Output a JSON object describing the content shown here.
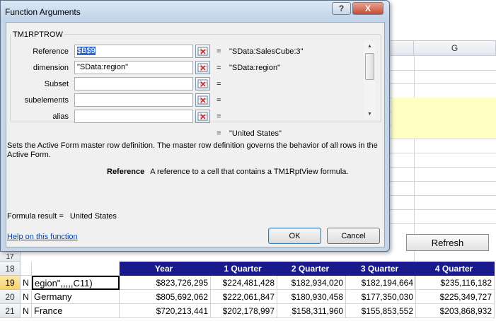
{
  "sheet": {
    "col_g": "G",
    "refresh": "Refresh",
    "row17": "17",
    "header": {
      "num": "18",
      "cols": [
        "Year",
        "1 Quarter",
        "2 Quarter",
        "3 Quarter",
        "4 Quarter"
      ]
    },
    "rows": [
      {
        "num": "19",
        "n": "N",
        "name": "egion\",,,,,C11)",
        "vals": [
          "$823,726,295",
          "$224,481,428",
          "$182,934,020",
          "$182,194,664",
          "$235,116,182"
        ]
      },
      {
        "num": "20",
        "n": "N",
        "name": "Germany",
        "vals": [
          "$805,692,062",
          "$222,061,847",
          "$180,930,458",
          "$177,350,030",
          "$225,349,727"
        ]
      },
      {
        "num": "21",
        "n": "N",
        "name": "France",
        "vals": [
          "$720,213,441",
          "$202,178,997",
          "$158,311,960",
          "$155,853,552",
          "$203,868,932"
        ]
      }
    ]
  },
  "dialog": {
    "title": "Function Arguments",
    "help_btn": "?",
    "close_btn": "X",
    "function_name": "TM1RPTROW",
    "args": [
      {
        "label": "Reference",
        "value": "$B$9",
        "result": "\"SData:SalesCube:3\""
      },
      {
        "label": "dimension",
        "value": "\"SData:region\"",
        "result": "\"SData:region\""
      },
      {
        "label": "Subset",
        "value": "",
        "result": ""
      },
      {
        "label": "subelements",
        "value": "",
        "result": ""
      },
      {
        "label": "alias",
        "value": "",
        "result": ""
      }
    ],
    "equals": "=",
    "function_result": "\"United States\"",
    "description": "Sets the Active Form master row definition. The master row definition governs the behavior of all rows in the Active Form.",
    "arg_name": "Reference",
    "arg_description": "A reference to a cell that contains a TM1RptView formula.",
    "formula_result_label": "Formula result =",
    "formula_result_value": "United States",
    "help_link": "Help on this function",
    "ok": "OK",
    "cancel": "Cancel"
  }
}
